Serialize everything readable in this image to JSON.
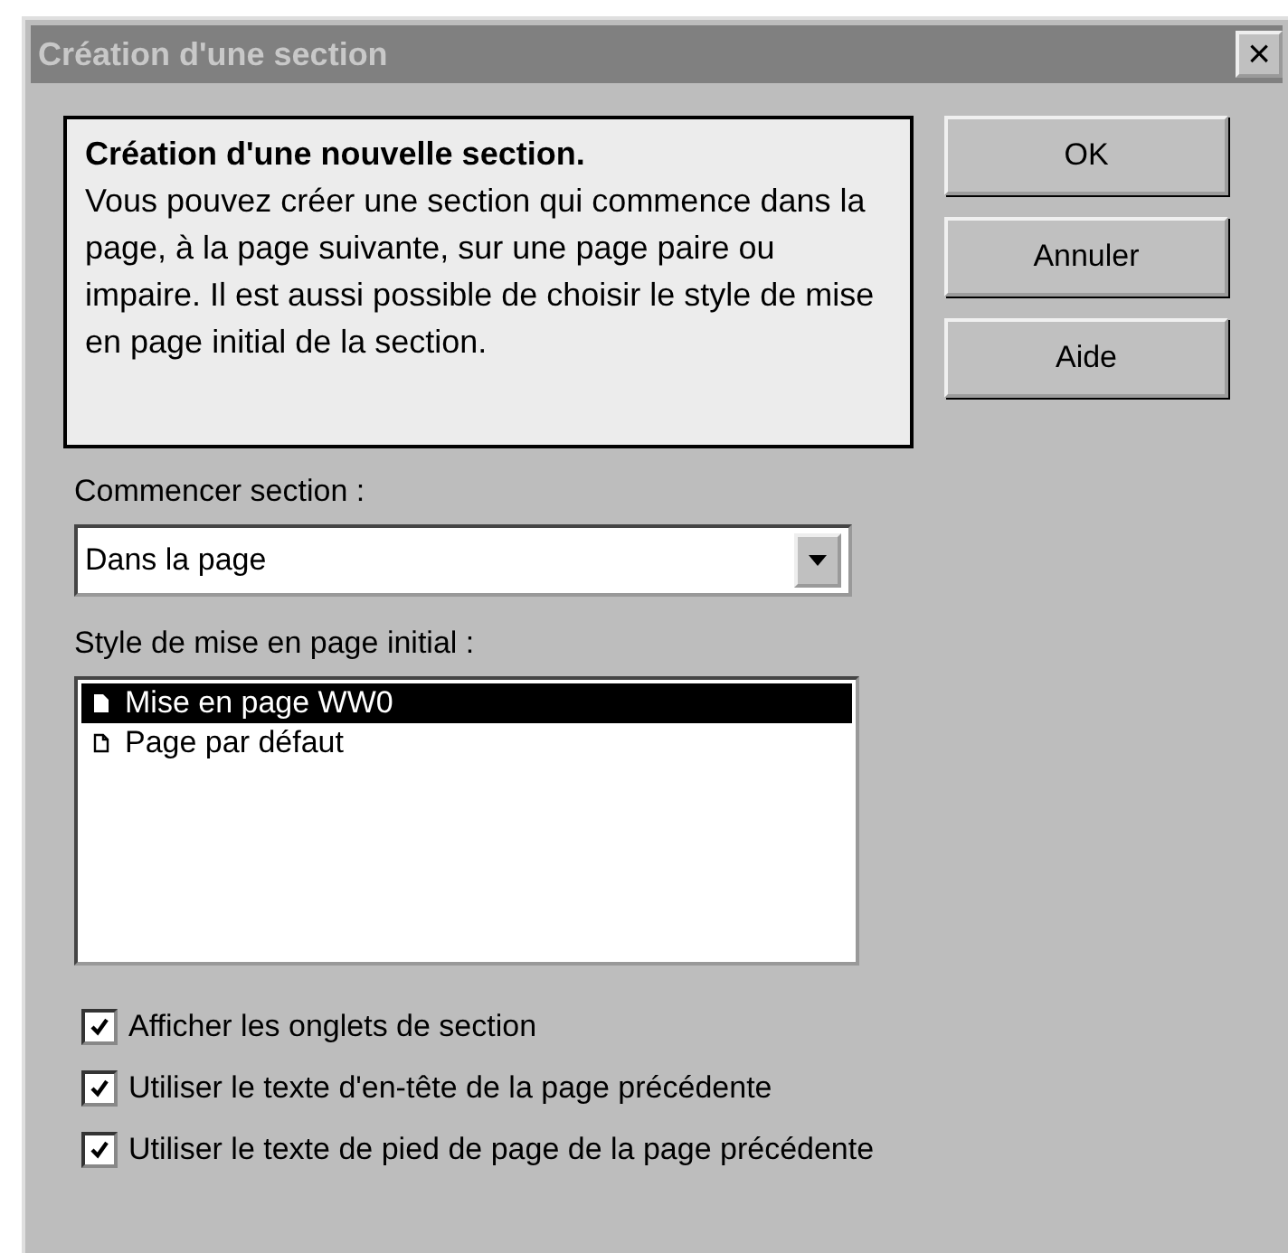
{
  "window": {
    "title": "Création d'une section",
    "close": "×"
  },
  "info": {
    "heading": "Création d'une nouvelle section.",
    "text": "Vous pouvez créer une section qui commence dans la page, à la page suivante, sur une page paire ou impaire. Il est aussi possible de choisir le style de mise en page initial de la section."
  },
  "buttons": [
    "OK",
    "Annuler",
    "Aide"
  ],
  "start": {
    "label": "Commencer section :",
    "value": "Dans la page"
  },
  "styles": {
    "label": "Style de mise en page initial :",
    "items": [
      {
        "label": "Mise en page WW0",
        "selected": true
      },
      {
        "label": "Page par défaut",
        "selected": false
      }
    ]
  },
  "options": [
    {
      "label": "Afficher les onglets de section",
      "checked": true
    },
    {
      "label": "Utiliser le texte d'en-tête de la page précédente",
      "checked": true
    },
    {
      "label": "Utiliser le texte de pied de page de la page précédente",
      "checked": true
    }
  ]
}
